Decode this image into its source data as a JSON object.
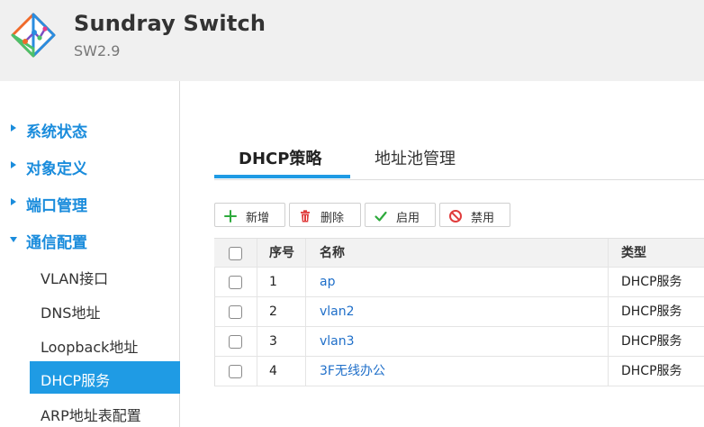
{
  "header": {
    "title": "Sundray Switch",
    "version": "SW2.9",
    "logo_icon": "sundray-logo-icon"
  },
  "sidebar": {
    "groups": [
      {
        "label": "系统状态",
        "expanded": false
      },
      {
        "label": "对象定义",
        "expanded": false
      },
      {
        "label": "端口管理",
        "expanded": false
      },
      {
        "label": "通信配置",
        "expanded": true
      }
    ],
    "sub_items": [
      {
        "label": "VLAN接口"
      },
      {
        "label": "DNS地址"
      },
      {
        "label": "Loopback地址"
      },
      {
        "label": "DHCP服务",
        "active": true
      },
      {
        "label": "ARP地址表配置"
      }
    ]
  },
  "tabs": [
    {
      "label": "DHCP策略",
      "active": true
    },
    {
      "label": "地址池管理",
      "active": false
    }
  ],
  "toolbar": {
    "add_label": "新增",
    "delete_label": "删除",
    "enable_label": "启用",
    "disable_label": "禁用"
  },
  "table": {
    "headers": {
      "index": "序号",
      "name": "名称",
      "type": "类型"
    },
    "rows": [
      {
        "index": "1",
        "name": "ap",
        "type": "DHCP服务"
      },
      {
        "index": "2",
        "name": "vlan2",
        "type": "DHCP服务"
      },
      {
        "index": "3",
        "name": "vlan3",
        "type": "DHCP服务"
      },
      {
        "index": "4",
        "name": "3F无线办公",
        "type": "DHCP服务"
      }
    ]
  },
  "colors": {
    "accent": "#1f9be4",
    "menu_text": "#1a8cdc",
    "link": "#1f6fc9",
    "add_icon": "#2eaa3c",
    "delete_icon": "#e03c3c",
    "enable_icon": "#2eaa3c",
    "disable_icon": "#e03c3c"
  }
}
